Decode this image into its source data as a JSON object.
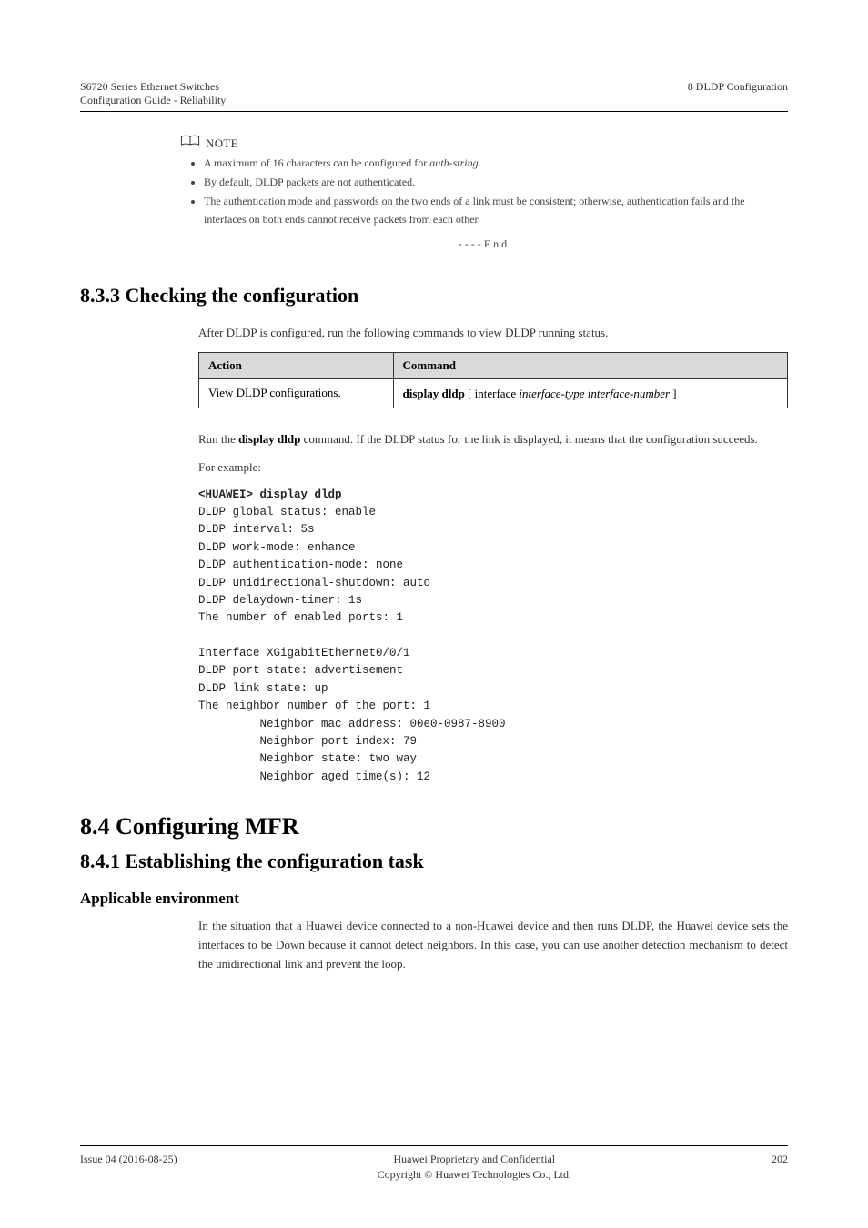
{
  "header": {
    "left_line1": "S6720 Series Ethernet Switches",
    "left_line2": "Configuration Guide - Reliability",
    "right": "8 DLDP Configuration"
  },
  "note": {
    "label": "NOTE",
    "items": [
      {
        "pre": "A maximum of 16 characters can be configured for ",
        "i": "auth-string",
        "post": "."
      },
      {
        "pre": "By default, DLDP packets are not authenticated.",
        "i": "",
        "post": ""
      },
      {
        "pre": "The authentication mode and passwords on the two ends of a link must be consistent; otherwise, authentication fails and the interfaces on both ends cannot receive packets from each other.",
        "i": "",
        "post": ""
      }
    ],
    "end": "----End"
  },
  "section833": {
    "title": "8.3.3 Checking the configuration",
    "intro": "After DLDP is configured, run the following commands to view DLDP running status.",
    "table": {
      "head_action": "Action",
      "head_command": "Command",
      "row_action": "View DLDP configurations.",
      "row_command_pre": "display dldp",
      "row_command_post": " [ interface ",
      "row_command_i": "interface-type interface-number",
      "row_command_tail": " ]"
    },
    "para1_pre": "Run the ",
    "para1_b": "display dldp",
    "para1_post": " command. If the DLDP status for the link is displayed, it means that the configuration succeeds.",
    "display_label": "For example:",
    "display_cmd": "<HUAWEI> display dldp",
    "display_text": "DLDP global status: enable\nDLDP interval: 5s\nDLDP work-mode: enhance\nDLDP authentication-mode: none\nDLDP unidirectional-shutdown: auto\nDLDP delaydown-timer: 1s\nThe number of enabled ports: 1\n\nInterface XGigabitEthernet0/0/1\nDLDP port state: advertisement\nDLDP link state: up\nThe neighbor number of the port: 1\n         Neighbor mac address: 00e0-0987-8900\n         Neighbor port index: 79\n         Neighbor state: two way\n         Neighbor aged time(s): 12"
  },
  "section84": {
    "title": "8.4 Configuring MFR",
    "sub": "8.4.1 Establishing the configuration task",
    "ae_title": "Applicable environment",
    "ae_para": "In the situation that a Huawei device connected to a non-Huawei device and then runs DLDP, the Huawei device sets the interfaces to be Down because it cannot detect neighbors. In this case, you can use another detection mechanism to detect the unidirectional link and prevent the loop."
  },
  "footer": {
    "left_line1": "Issue 04 (2016-08-25)",
    "center_line1": "Huawei Proprietary and Confidential",
    "center_line2": "Copyright © Huawei Technologies Co., Ltd.",
    "right": "202"
  }
}
